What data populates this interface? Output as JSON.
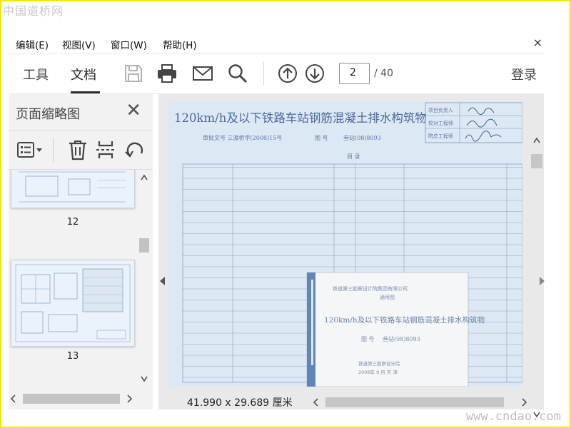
{
  "watermarks": {
    "top_left": "中国道桥网",
    "bottom_right": "www.cndao.com"
  },
  "menu": {
    "items": [
      "编辑(E)",
      "视图(V)",
      "窗口(W)",
      "帮助(H)"
    ],
    "close_glyph": "×"
  },
  "toolbar": {
    "tabs": [
      "工具",
      "文档"
    ],
    "active_tab": "文档",
    "icons": [
      "save-icon",
      "print-icon",
      "email-icon",
      "search-icon",
      "page-up-icon",
      "page-down-icon"
    ],
    "page_current": "2",
    "page_total": "/ 40",
    "login_label": "登录"
  },
  "sidebar": {
    "title": "页面缩略图",
    "close_glyph": "✕",
    "tool_icons": [
      "thumbnail-options-icon",
      "delete-icon",
      "extract-pages-icon",
      "rotate-icon"
    ],
    "thumbnails": [
      {
        "label": "12"
      },
      {
        "label": "13"
      }
    ]
  },
  "document": {
    "title": "120km/h及以下铁路车站钢筋混凝土排水构筑物",
    "approval_text": "审批文号 三渡桥字(2008)15号",
    "drawing_no_label": "图 号",
    "drawing_no": "叁站(08)8093",
    "signature_roles": [
      "项目负责人",
      "校对工程师",
      "院总工程师"
    ],
    "table_header": "目 录",
    "cover": {
      "company": "铁道第三勘察设计院集团有限公司",
      "type": "通用图",
      "title": "120km/h及以下铁路车站钢筋混凝土排水构筑物",
      "drawing_no_label": "图 号",
      "drawing_no": "叁站(08)8093",
      "publisher": "铁道第三勘察设计院",
      "date": "2008年 9 月  天 津"
    }
  },
  "status": {
    "page_size": "41.990 x 29.689 厘米"
  }
}
